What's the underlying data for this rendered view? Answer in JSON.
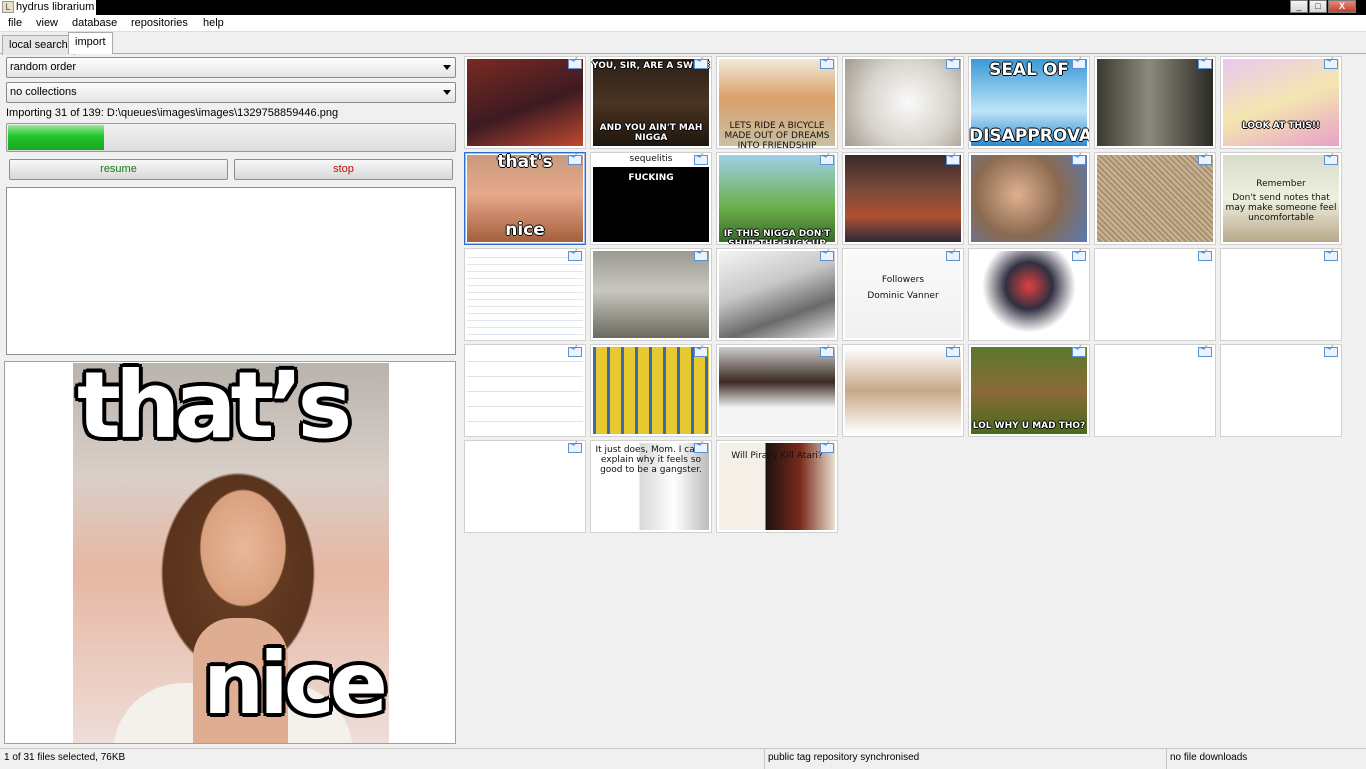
{
  "window": {
    "title": "hydrus librarium",
    "minimize": "_",
    "maximize": "□",
    "close": "X"
  },
  "menu": [
    "file",
    "view",
    "database",
    "repositories",
    "help"
  ],
  "tabs": {
    "local_search": "local search",
    "import": "import"
  },
  "left": {
    "sort_select": "random order",
    "collect_select": "no collections",
    "status": "Importing 31 of 139: D:\\queues\\images\\images\\1329758859446.png",
    "progress_fraction": 0.215,
    "resume_label": "resume",
    "stop_label": "stop",
    "preview": {
      "top_text": "that’s",
      "bottom_text": "nice"
    }
  },
  "thumbnails": [
    {
      "name": "thumb-anime-girls",
      "bg": "linear-gradient(160deg,#7a2a22,#3d1a22 55%,#c04a30)",
      "caps": []
    },
    {
      "name": "thumb-swine-meme",
      "bg": "linear-gradient(180deg,#2c2016,#4a3422 50%,#1e160e)",
      "caps": [
        {
          "t": "YOU, SIR, ARE A SWINE",
          "y": 4
        },
        {
          "t": "AND YOU AIN'T MAH NIGGA",
          "y": 66
        }
      ]
    },
    {
      "name": "thumb-corgi",
      "bg": "linear-gradient(180deg,#f0ead8,#d9a06a 45%,#c9c0a4)",
      "caps": [
        {
          "t": "LETS RIDE A BICYCLE MADE OUT OF DREAMS INTO FRIENDSHIP",
          "y": 64,
          "dark": true
        }
      ]
    },
    {
      "name": "thumb-cat",
      "bg": "radial-gradient(circle at 55% 50%,#fafafa,#d8d4cc 55%,#a09a90)",
      "caps": []
    },
    {
      "name": "thumb-seal-of-disapproval",
      "bg": "linear-gradient(180deg,#3a9ad8,#bfe4f8 60%,#2a8ad0)",
      "caps": [
        {
          "t": "SEAL OF",
          "y": 4,
          "big": true
        },
        {
          "t": "DISAPPROVAL",
          "y": 70,
          "big": true
        }
      ]
    },
    {
      "name": "thumb-dark-hallway",
      "bg": "linear-gradient(90deg,#3a3a32,#8a8a7c 45%,#2a2a24)",
      "caps": []
    },
    {
      "name": "thumb-look-at-this",
      "bg": "linear-gradient(160deg,#e8c8f0,#f4e6b0 50%,#e8a0c8)",
      "caps": [
        {
          "t": "LOOK AT THIS!!",
          "y": 64,
          "big": false
        }
      ]
    },
    {
      "name": "thumb-thats-nice",
      "bg": "linear-gradient(180deg,#c89a7c,#e6a88c 45%,#a4603c)",
      "caps": [
        {
          "t": "that's",
          "y": 0,
          "big": true
        },
        {
          "t": "nice",
          "y": 68,
          "big": true
        }
      ]
    },
    {
      "name": "thumb-sequelitis",
      "bg": "linear-gradient(180deg,#fff 0,#fff 14%,#000 14%,#000 100%)",
      "caps": [
        {
          "t": "sequelitis",
          "y": 1,
          "dark": true
        },
        {
          "t": "FUCKING",
          "y": 20
        }
      ]
    },
    {
      "name": "thumb-zelda",
      "bg": "linear-gradient(180deg,#9fd0e8,#6ab04a 60%,#3a6a2a)",
      "caps": [
        {
          "t": "IF THIS NIGGA DON'T SHUT THE FUCK UP",
          "y": 76
        }
      ]
    },
    {
      "name": "thumb-basketball-crowd",
      "bg": "linear-gradient(180deg,#3a2a2a,#7a4a3a 40%,#b05030 70%,#2a2a3a)",
      "caps": []
    },
    {
      "name": "thumb-webcam-guy",
      "bg": "radial-gradient(circle at 40% 45%,#e0b090,#8a6a50 50%,#5a7ab0)",
      "caps": []
    },
    {
      "name": "thumb-texture",
      "bg": "repeating-linear-gradient(45deg,#c8b494,#c8b494 2px,#a89070 2px,#a89070 4px)",
      "caps": []
    },
    {
      "name": "thumb-remember-note",
      "bg": "linear-gradient(180deg,#d8dcc8,#eef0e0 50%,#b8a888)",
      "caps": [
        {
          "t": "Remember",
          "y": 26,
          "dark": true
        },
        {
          "t": "Don't send notes that may make someone feel uncomfortable",
          "y": 40,
          "dark": true
        }
      ]
    },
    {
      "name": "thumb-tweet-list",
      "bg": "repeating-linear-gradient(180deg,#fff,#fff 6px,#e0e6ee 6px,#e0e6ee 7px)",
      "caps": []
    },
    {
      "name": "thumb-car-rain",
      "bg": "linear-gradient(180deg,#9a9a92,#c8c8c0 45%,#6a6a60)",
      "caps": []
    },
    {
      "name": "thumb-manga",
      "bg": "linear-gradient(160deg,#f4f4f4,#c8c8c8 40%,#6a6a6a 70%,#e8e8e8)",
      "caps": []
    },
    {
      "name": "thumb-followers",
      "bg": "linear-gradient(180deg,#fafafa,#f0f0f0)",
      "caps": [
        {
          "t": "Followers",
          "y": 26,
          "dark": true
        },
        {
          "t": "Dominic Vanner",
          "y": 42,
          "dark": true
        }
      ]
    },
    {
      "name": "thumb-robot-girl",
      "bg": "radial-gradient(circle at 50% 40%,#e04040,#303040 30%,#fff 60%)",
      "caps": []
    },
    {
      "name": "thumb-tweet-1",
      "bg": "linear-gradient(180deg,#fff,#fff)",
      "caps": []
    },
    {
      "name": "thumb-tweet-2",
      "bg": "linear-gradient(180deg,#fff,#fff)",
      "caps": []
    },
    {
      "name": "thumb-tweet-3",
      "bg": "repeating-linear-gradient(180deg,#fff,#fff 14px,#dde4ee 14px,#dde4ee 15px)",
      "caps": []
    },
    {
      "name": "thumb-simpsons",
      "bg": "repeating-linear-gradient(90deg,#3a6ab0,#3a6ab0 3px,#e8c830 3px,#e8c830 14px)",
      "caps": []
    },
    {
      "name": "thumb-laughing-women",
      "bg": "linear-gradient(180deg,#ccc,#3a2a22 40%,#f4f4f4 70%)",
      "caps": []
    },
    {
      "name": "thumb-old-men",
      "bg": "linear-gradient(180deg,#fff,#c8a888 50%,#fff)",
      "caps": []
    },
    {
      "name": "thumb-duck",
      "bg": "linear-gradient(180deg,#5a7a2a,#8a6a3a 50%,#4a6a1a)",
      "caps": [
        {
          "t": "LOL WHY U MAD THO?",
          "y": 76
        }
      ]
    },
    {
      "name": "thumb-tweet-4",
      "bg": "linear-gradient(180deg,#fff,#fff)",
      "caps": []
    },
    {
      "name": "thumb-tweet-5",
      "bg": "linear-gradient(180deg,#fff,#fff)",
      "caps": []
    },
    {
      "name": "thumb-tweet-6",
      "bg": "linear-gradient(180deg,#fff,#fff)",
      "caps": []
    },
    {
      "name": "thumb-gangster-comic",
      "bg": "linear-gradient(90deg,#fff 40%,#d8d8d8 40%,#fff 70%,#bbb)",
      "caps": [
        {
          "t": "It just does, Mom. I can't explain why it feels so good to be a gangster.",
          "y": 4,
          "dark": true
        }
      ]
    },
    {
      "name": "thumb-will-piracy-kill-atari",
      "bg": "linear-gradient(90deg,#f4f0e8 40%,#1a1210 40%,#7a2a1a 70%,#e8e0d0)",
      "caps": [
        {
          "t": "Will Piracy Kill Atari?",
          "y": 10,
          "dark": true
        }
      ]
    }
  ],
  "statusbar": {
    "selection": "1 of 31 files selected, 76KB",
    "repo": "public tag repository synchronised",
    "downloads": "no file downloads"
  }
}
